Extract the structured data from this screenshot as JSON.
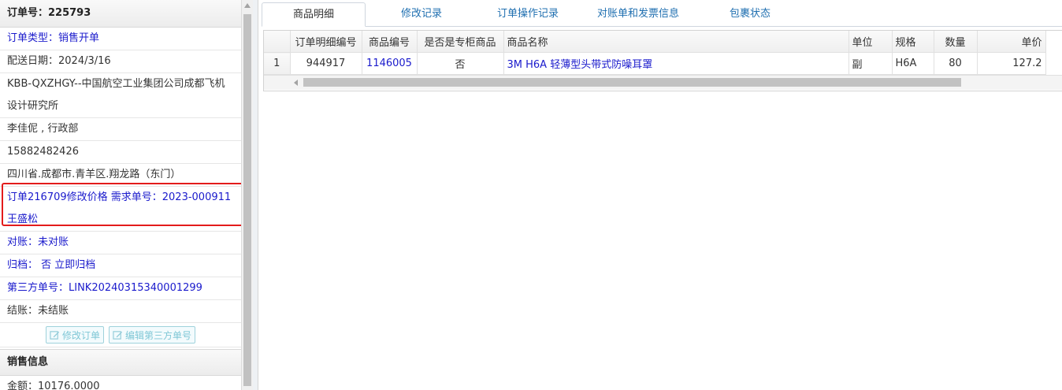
{
  "left": {
    "order_no": "订单号：225793",
    "rows": [
      {
        "text": "订单类型：销售开单",
        "blue": true
      },
      {
        "text": "配送日期：2024/3/16",
        "blue": false
      },
      {
        "text": "KBB-QXZHGY--中国航空工业集团公司成都飞机设计研究所",
        "blue": false
      },
      {
        "text": "李佳伲 , 行政部",
        "blue": false
      },
      {
        "text": "15882482426",
        "blue": false
      },
      {
        "text": "四川省.成都市.青羊区.翔龙路（东门）",
        "blue": false
      },
      {
        "text": "订单216709修改价格 需求单号：2023-000911王盛松",
        "blue": true
      },
      {
        "text": "对账：未对账",
        "blue": true
      },
      {
        "text": "归档： 否 立即归档",
        "blue": true
      },
      {
        "text": "第三方单号：LINK20240315340001299",
        "blue": true
      },
      {
        "text": "结账：未结账",
        "blue": false
      }
    ],
    "buttons": {
      "edit_order": "修改订单",
      "edit_third": "编辑第三方单号"
    },
    "sales_info": "销售信息",
    "amount": "金额：10176.0000"
  },
  "tabs": [
    "商品明细",
    "修改记录",
    "订单操作记录",
    "对账单和发票信息",
    "包裹状态"
  ],
  "grid": {
    "columns": [
      "订单明细编号",
      "商品编号",
      "是否是专柜商品",
      "商品名称",
      "单位",
      "规格",
      "数量",
      "单价"
    ],
    "rows": [
      {
        "index": "1",
        "detail_no": "944917",
        "product_no": "1146005",
        "counter": "否",
        "name": "3M H6A 轻薄型头带式防噪耳罩",
        "unit": "副",
        "spec": "H6A",
        "qty": "80",
        "price": "127.2"
      }
    ]
  }
}
